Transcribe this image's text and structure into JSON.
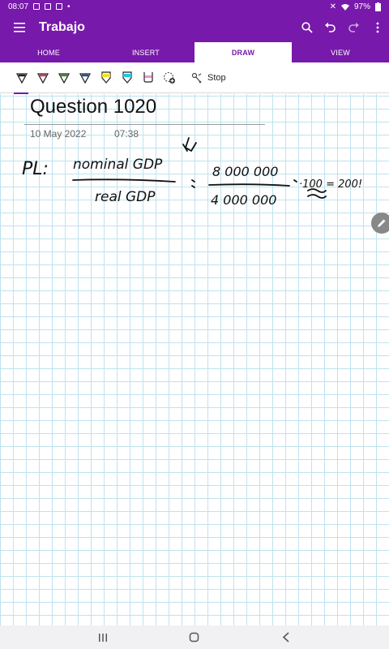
{
  "status_bar": {
    "time": "08:07",
    "battery": "97%"
  },
  "app_bar": {
    "title": "Trabajo"
  },
  "tabs": [
    {
      "label": "HOME",
      "active": false
    },
    {
      "label": "INSERT",
      "active": false
    },
    {
      "label": "DRAW",
      "active": true
    },
    {
      "label": "VIEW",
      "active": false
    }
  ],
  "toolbar": {
    "pens": [
      {
        "name": "black-pen",
        "color": "#222222"
      },
      {
        "name": "red-pen",
        "color": "#d23b5a"
      },
      {
        "name": "green-pen",
        "color": "#3f8f2d"
      },
      {
        "name": "blue-pen",
        "color": "#1d4f9e"
      },
      {
        "name": "yellow-highlighter",
        "color": "#f2e227"
      },
      {
        "name": "cyan-highlighter",
        "color": "#27c6e0"
      },
      {
        "name": "pink-highlighter",
        "color": "#ec95c9"
      }
    ],
    "stop_label": "Stop"
  },
  "page": {
    "title": "Question 1020",
    "date": "10 May 2022",
    "time": "07:38",
    "handwriting": {
      "label": "PL:",
      "numerator": "nominal GDP",
      "denominator": "real GDP",
      "value_numerator": "8 000 000",
      "value_denominator": "4 000 000",
      "result": "·100 = 200!"
    }
  },
  "colors": {
    "accent": "#7719aa",
    "grid": "#bfe3ef",
    "ink": "#111111"
  }
}
